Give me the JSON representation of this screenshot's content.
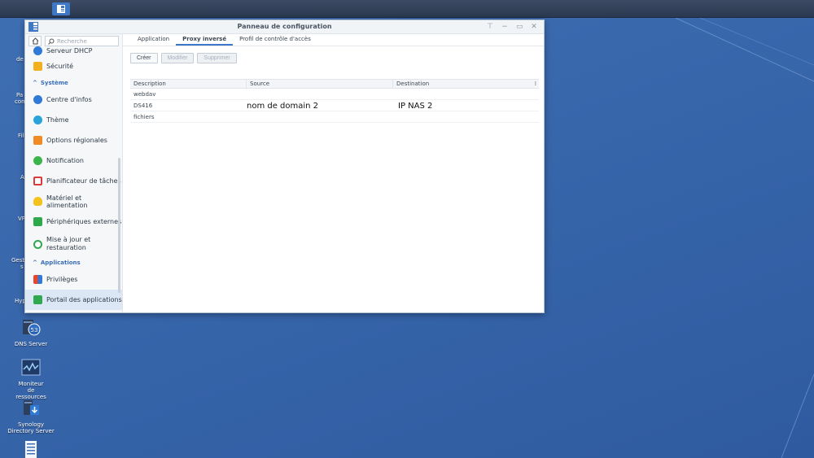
{
  "window": {
    "title": "Panneau de configuration",
    "controls": [
      "pin",
      "minimize",
      "maximize",
      "close"
    ]
  },
  "sidebar": {
    "search_placeholder": "Recherche",
    "items": [
      {
        "label": "Serveur DHCP",
        "icon": "dhcp-icon"
      },
      {
        "label": "Sécurité",
        "icon": "shield-icon"
      },
      {
        "category": "Système"
      },
      {
        "label": "Centre d'infos",
        "icon": "info-icon"
      },
      {
        "label": "Thème",
        "icon": "palette-icon"
      },
      {
        "label": "Options régionales",
        "icon": "calendar-icon"
      },
      {
        "label": "Notification",
        "icon": "chat-icon"
      },
      {
        "label": "Planificateur de tâches",
        "icon": "checklist-icon"
      },
      {
        "label": "Matériel et alimentation",
        "icon": "bulb-icon"
      },
      {
        "label": "Périphériques externes",
        "icon": "usb-icon"
      },
      {
        "label": "Mise à jour et",
        "label2": "restauration",
        "icon": "update-icon"
      },
      {
        "category": "Applications"
      },
      {
        "label": "Privilèges",
        "icon": "tiles-icon"
      },
      {
        "label": "Portail des applications",
        "icon": "portal-icon",
        "active": true
      }
    ]
  },
  "tabs": [
    {
      "label": "Application",
      "active": false
    },
    {
      "label": "Proxy inversé",
      "active": true
    },
    {
      "label": "Profil de contrôle d'accès",
      "active": false
    }
  ],
  "toolbar": {
    "create": "Créer",
    "edit": "Modifier",
    "delete": "Supprimer"
  },
  "table": {
    "columns": [
      "Description",
      "Source",
      "Destination"
    ],
    "rows": [
      {
        "description": "webdav",
        "source": "",
        "destination": ""
      },
      {
        "description": "DS416",
        "source": "nom de domain 2",
        "destination": "IP NAS 2"
      },
      {
        "description": "fichiers",
        "source": "",
        "destination": ""
      }
    ]
  },
  "desktop": {
    "icons": [
      {
        "label": "DNS Server",
        "icon": "dns-server-icon"
      },
      {
        "label": "Moniteur de ressources",
        "icon": "resource-monitor-icon"
      },
      {
        "label": "Synology Directory Server",
        "icon": "directory-server-icon"
      },
      {
        "label": "",
        "icon": "document-icon"
      }
    ],
    "fragments": [
      "de",
      "Pa",
      "con",
      "Fil",
      "A",
      "VP",
      "Gest",
      "s",
      "Hyp"
    ]
  },
  "colors": {
    "accent": "#3b78c9",
    "desktop": "#3a68ad",
    "taskbar": "#2f3d55"
  }
}
